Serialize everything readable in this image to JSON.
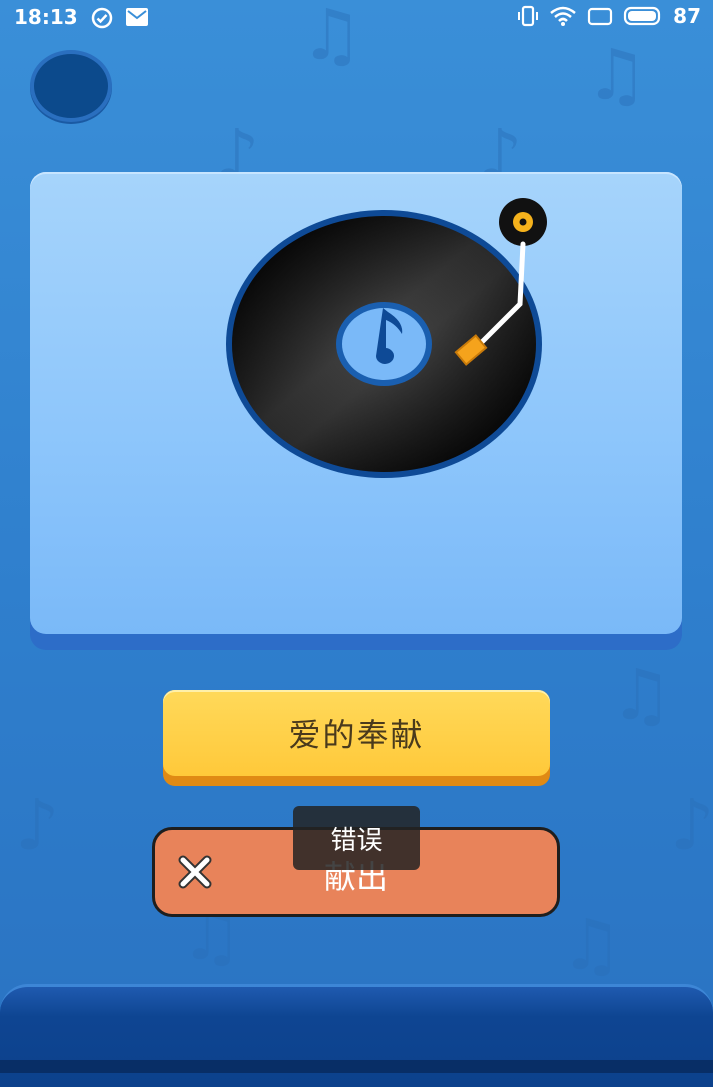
{
  "status_bar": {
    "time": "18:13",
    "battery": "87",
    "icons": [
      "check-circle-icon",
      "mail-icon",
      "vibrate-icon",
      "wifi-icon",
      "screen-icon",
      "battery-icon"
    ]
  },
  "colors": {
    "background": "#3a8fd8",
    "card": "#8cc5fb",
    "primary_button": "#ffc93a",
    "submit_button": "#e8835a",
    "bottom_panel": "#0e4592"
  },
  "card": {
    "icon": "vinyl-record-turntable-icon"
  },
  "primary_button": {
    "label": "爱的奉献"
  },
  "submit_button": {
    "label": "献出",
    "icon": "close-icon"
  },
  "toast": {
    "text": "错误"
  }
}
